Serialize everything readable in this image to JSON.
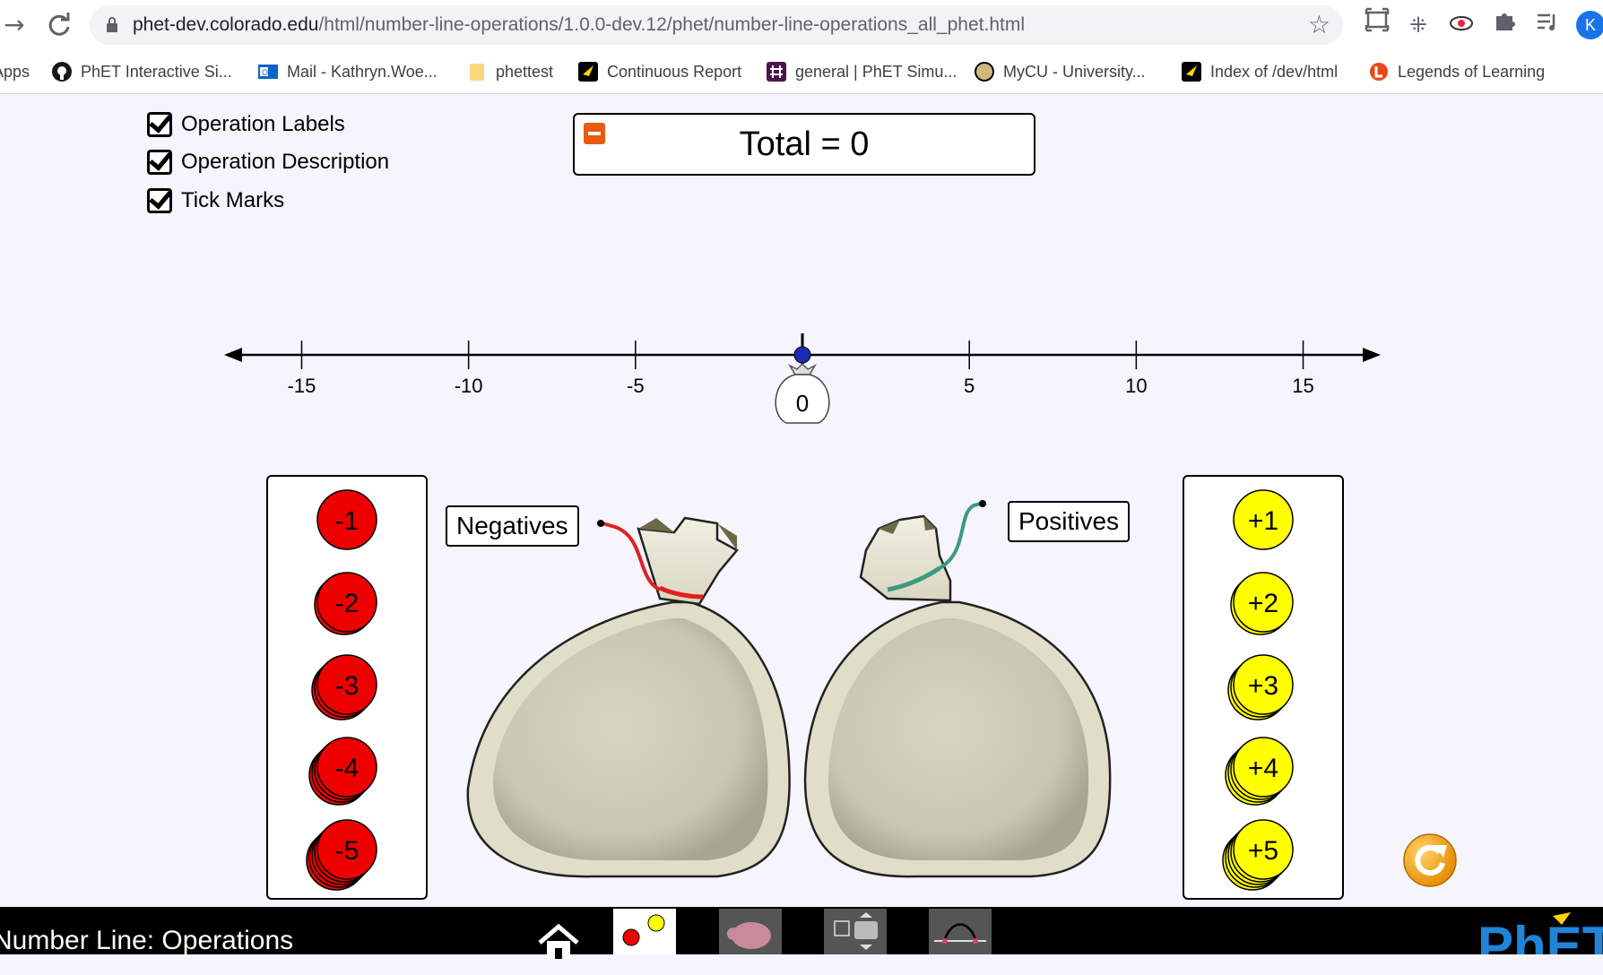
{
  "browser": {
    "back": "→",
    "reload": "⟳",
    "url_host": "phet-dev.colorado.edu",
    "url_path": "/html/number-line-operations/1.0.0-dev.12/phet/number-line-operations_all_phet.html",
    "profile_initial": "K"
  },
  "bookmarks": [
    {
      "label": "Apps",
      "icon": "apps-grid"
    },
    {
      "label": "PhET Interactive Si...",
      "icon": "github-icon"
    },
    {
      "label": "Mail - Kathryn.Woe...",
      "icon": "outlook-icon"
    },
    {
      "label": "phettest",
      "icon": "folder-icon"
    },
    {
      "label": "Continuous Report",
      "icon": "phet-icon"
    },
    {
      "label": "general | PhET Simu...",
      "icon": "slack-icon"
    },
    {
      "label": "MyCU - University...",
      "icon": "cu-icon"
    },
    {
      "label": "Index of /dev/html",
      "icon": "phet-icon"
    },
    {
      "label": "Legends of Learning",
      "icon": "legends-icon"
    }
  ],
  "checkboxes": [
    {
      "label": "Operation Labels",
      "checked": true
    },
    {
      "label": "Operation Description",
      "checked": true
    },
    {
      "label": "Tick Marks",
      "checked": true
    }
  ],
  "total": {
    "label": "Total = 0"
  },
  "number_line": {
    "min": -17,
    "max": 17,
    "tick_labels": [
      "-15",
      "-10",
      "-5",
      "0",
      "5",
      "10",
      "15"
    ],
    "point_value": 0,
    "point_color": "#1a2db4",
    "bag_value": "0"
  },
  "bags": {
    "negatives_label": "Negatives",
    "positives_label": "Positives",
    "negatives_string_color": "#e02020",
    "positives_string_color": "#3a9a80"
  },
  "negative_chips": [
    "-1",
    "-2",
    "-3",
    "-4",
    "-5"
  ],
  "positive_chips": [
    "+1",
    "+2",
    "+3",
    "+4",
    "+5"
  ],
  "colors": {
    "negative": "#ee0000",
    "positive": "#ffff00",
    "reset": "#f4a11a"
  },
  "navbar": {
    "title": "Number Line: Operations",
    "screens": [
      "chips-screen",
      "net-worth-screen",
      "generic-screen",
      "operations-screen"
    ]
  }
}
